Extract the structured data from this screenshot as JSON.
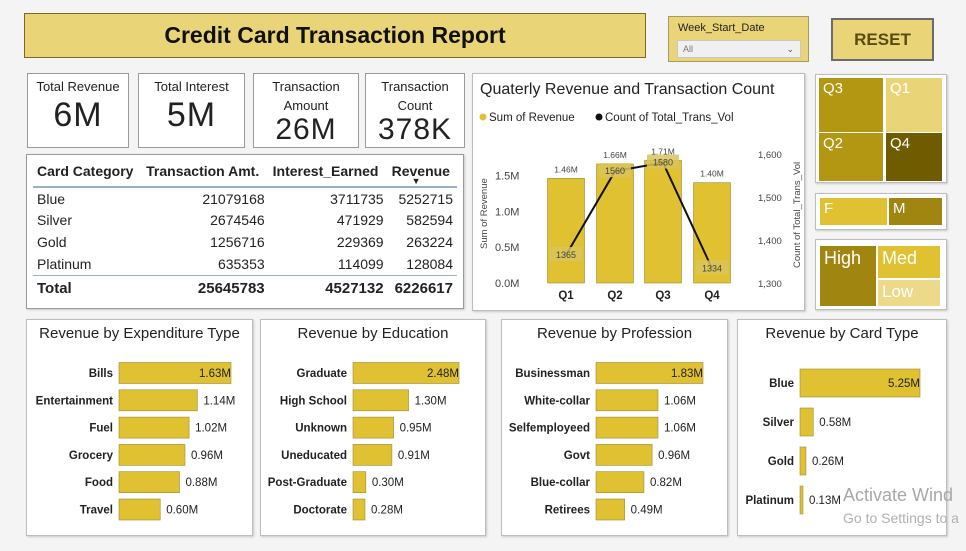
{
  "header": {
    "title": "Credit Card Transaction Report"
  },
  "filter": {
    "label": "Week_Start_Date",
    "value": "All"
  },
  "reset_label": "RESET",
  "kpis": [
    {
      "label": "Total Revenue",
      "value": "6M"
    },
    {
      "label": "Total Interest",
      "value": "5M"
    },
    {
      "label": "Transaction Amount",
      "value": "26M"
    },
    {
      "label": "Transaction Count",
      "value": "378K"
    }
  ],
  "table": {
    "headers": [
      "Card Category",
      "Transaction Amt.",
      "Interest_Earned",
      "Revenue"
    ],
    "rows": [
      [
        "Blue",
        "21079168",
        "3711735",
        "5252715"
      ],
      [
        "Silver",
        "2674546",
        "471929",
        "582594"
      ],
      [
        "Gold",
        "1256716",
        "229369",
        "263224"
      ],
      [
        "Platinum",
        "635353",
        "114099",
        "128084"
      ]
    ],
    "total": [
      "Total",
      "25645783",
      "4527132",
      "6226617"
    ]
  },
  "quarter_slicer": [
    "Q3",
    "Q1",
    "Q2",
    "Q4"
  ],
  "gender_slicer": [
    "F",
    "M"
  ],
  "income_slicer": [
    "High",
    "Med",
    "Low"
  ],
  "colors": {
    "bar": "#e0c132",
    "dark": "#b39713",
    "accent_dark": "#6f5c00"
  },
  "watermark": {
    "line1": "Activate Wind",
    "line2": "Go to Settings to a"
  },
  "chart_data": [
    {
      "type": "bar+line",
      "title": "Quaterly Revenue and Transaction Count",
      "legend": [
        "Sum of Revenue",
        "Count of Total_Trans_Vol"
      ],
      "legend_position": "top-left",
      "categories": [
        "Q1",
        "Q2",
        "Q3",
        "Q4"
      ],
      "bar_labels": [
        "1.46M",
        "1.66M",
        "1.71M",
        "1.40M"
      ],
      "series": [
        {
          "name": "Sum of Revenue",
          "type": "bar",
          "values": [
            1.46,
            1.66,
            1.71,
            1.4
          ]
        },
        {
          "name": "Count of Total_Trans_Vol",
          "type": "line",
          "values": [
            1365,
            1560,
            1580,
            1334
          ],
          "labels": [
            "1365",
            "1560",
            "1580",
            "1334"
          ]
        }
      ],
      "ylabel": "Sum of Revenue",
      "y2label": "Count of Total_Trans_Vol",
      "yticks": [
        "1.5M",
        "1.0M",
        "0.5M",
        "0.0M"
      ],
      "ylim": [
        0,
        1.8
      ],
      "y2ticks": [
        "1,600",
        "1,500",
        "1,400",
        "1,300"
      ],
      "y2lim": [
        1300,
        1600
      ]
    },
    {
      "type": "bar",
      "title": "Revenue by Expenditure Type",
      "categories": [
        "Bills",
        "Entertainment",
        "Fuel",
        "Grocery",
        "Food",
        "Travel"
      ],
      "values": [
        1.63,
        1.14,
        1.02,
        0.96,
        0.88,
        0.6
      ],
      "labels": [
        "1.63M",
        "1.14M",
        "1.02M",
        "0.96M",
        "0.88M",
        "0.60M"
      ]
    },
    {
      "type": "bar",
      "title": "Revenue by Education",
      "categories": [
        "Graduate",
        "High School",
        "Unknown",
        "Uneducated",
        "Post-Graduate",
        "Doctorate"
      ],
      "values": [
        2.48,
        1.3,
        0.95,
        0.91,
        0.3,
        0.28
      ],
      "labels": [
        "2.48M",
        "1.30M",
        "0.95M",
        "0.91M",
        "0.30M",
        "0.28M"
      ]
    },
    {
      "type": "bar",
      "title": "Revenue by Profession",
      "categories": [
        "Businessman",
        "White-collar",
        "Selfemployeed",
        "Govt",
        "Blue-collar",
        "Retirees"
      ],
      "values": [
        1.83,
        1.06,
        1.06,
        0.96,
        0.82,
        0.49
      ],
      "labels": [
        "1.83M",
        "1.06M",
        "1.06M",
        "0.96M",
        "0.82M",
        "0.49M"
      ]
    },
    {
      "type": "bar",
      "title": "Revenue by Card Type",
      "categories": [
        "Blue",
        "Silver",
        "Gold",
        "Platinum"
      ],
      "values": [
        5.25,
        0.58,
        0.26,
        0.13
      ],
      "labels": [
        "5.25M",
        "0.58M",
        "0.26M",
        "0.13M"
      ]
    }
  ]
}
